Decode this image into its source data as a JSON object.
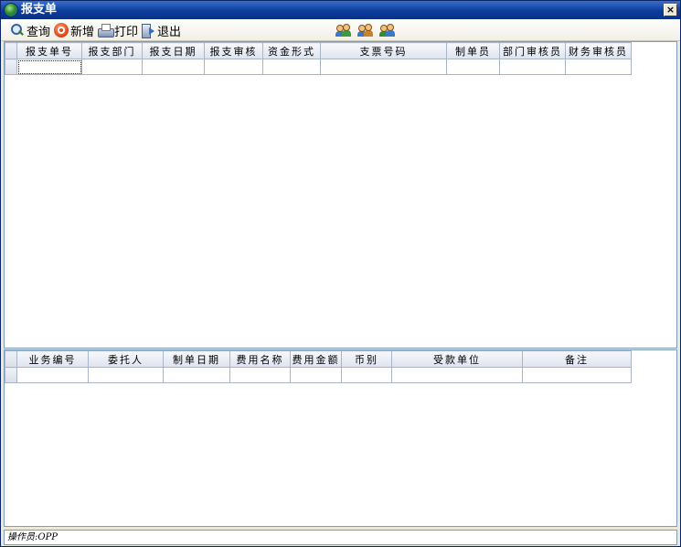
{
  "window": {
    "title": "报支单",
    "close_label": "×"
  },
  "toolbar": {
    "query_label": "查询",
    "add_label": "新增",
    "print_label": "打印",
    "exit_label": "退出",
    "icons": [
      "search-icon",
      "add-icon",
      "printer-icon",
      "exit-door-icon",
      "users-icon",
      "users-icon",
      "users-icon"
    ]
  },
  "top_grid": {
    "columns": [
      "报支单号",
      "报支部门",
      "报支日期",
      "报支审核",
      "资金形式",
      "支票号码",
      "制单员",
      "部门审核员",
      "财务审核员"
    ],
    "rows": [
      [
        "",
        "",
        "",
        "",
        "",
        "",
        "",
        "",
        ""
      ]
    ]
  },
  "bottom_grid": {
    "columns": [
      "业务编号",
      "委托人",
      "制单日期",
      "费用名称",
      "费用金额",
      "币别",
      "受款单位",
      "备注"
    ],
    "rows": [
      [
        "",
        "",
        "",
        "",
        "",
        "",
        "",
        ""
      ]
    ]
  },
  "status": {
    "text": "操作员:OPP"
  },
  "colors": {
    "titlebar": "#0a3d9c",
    "header_bg": "#dde3ef",
    "grid_border": "#a9b4c6",
    "pane_border": "#7f9db9"
  }
}
